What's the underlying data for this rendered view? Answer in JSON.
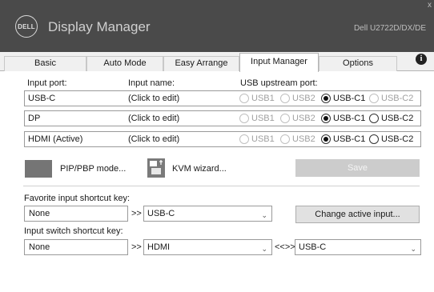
{
  "app": {
    "logo_text": "DELL",
    "title": "Display Manager",
    "monitor_model": "Dell U2722D/DX/DE",
    "close_glyph": "x"
  },
  "tabs": [
    {
      "label": "Basic"
    },
    {
      "label": "Auto Mode"
    },
    {
      "label": "Easy Arrange"
    },
    {
      "label": "Input Manager"
    },
    {
      "label": "Options"
    }
  ],
  "info_glyph": "i",
  "table": {
    "headers": {
      "port": "Input port:",
      "name": "Input name:",
      "usb": "USB upstream port:"
    },
    "rows": [
      {
        "port": "USB-C",
        "name": "(Click to edit)",
        "usb_options": [
          "USB1",
          "USB2",
          "USB-C1",
          "USB-C2"
        ],
        "selected": "USB-C1",
        "usb_c2_enabled": false
      },
      {
        "port": "DP",
        "name": "(Click to edit)",
        "usb_options": [
          "USB1",
          "USB2",
          "USB-C1",
          "USB-C2"
        ],
        "selected": "USB-C1",
        "usb_c2_enabled": true
      },
      {
        "port": "HDMI (Active)",
        "name": "(Click to edit)",
        "usb_options": [
          "USB1",
          "USB2",
          "USB-C1",
          "USB-C2"
        ],
        "selected": "USB-C1",
        "usb_c2_enabled": true
      }
    ]
  },
  "actions": {
    "pip_label": "PIP/PBP mode...",
    "kvm_label": "KVM wizard...",
    "save_label": "Save"
  },
  "favorite": {
    "label": "Favorite input shortcut key:",
    "key_value": "None",
    "arrow": ">>",
    "input_value": "USB-C",
    "button_label": "Change active input..."
  },
  "switch": {
    "label": "Input switch shortcut key:",
    "key_value": "None",
    "arrow": ">>",
    "input_a": "HDMI",
    "swap": "<<>>",
    "input_b": "USB-C"
  }
}
